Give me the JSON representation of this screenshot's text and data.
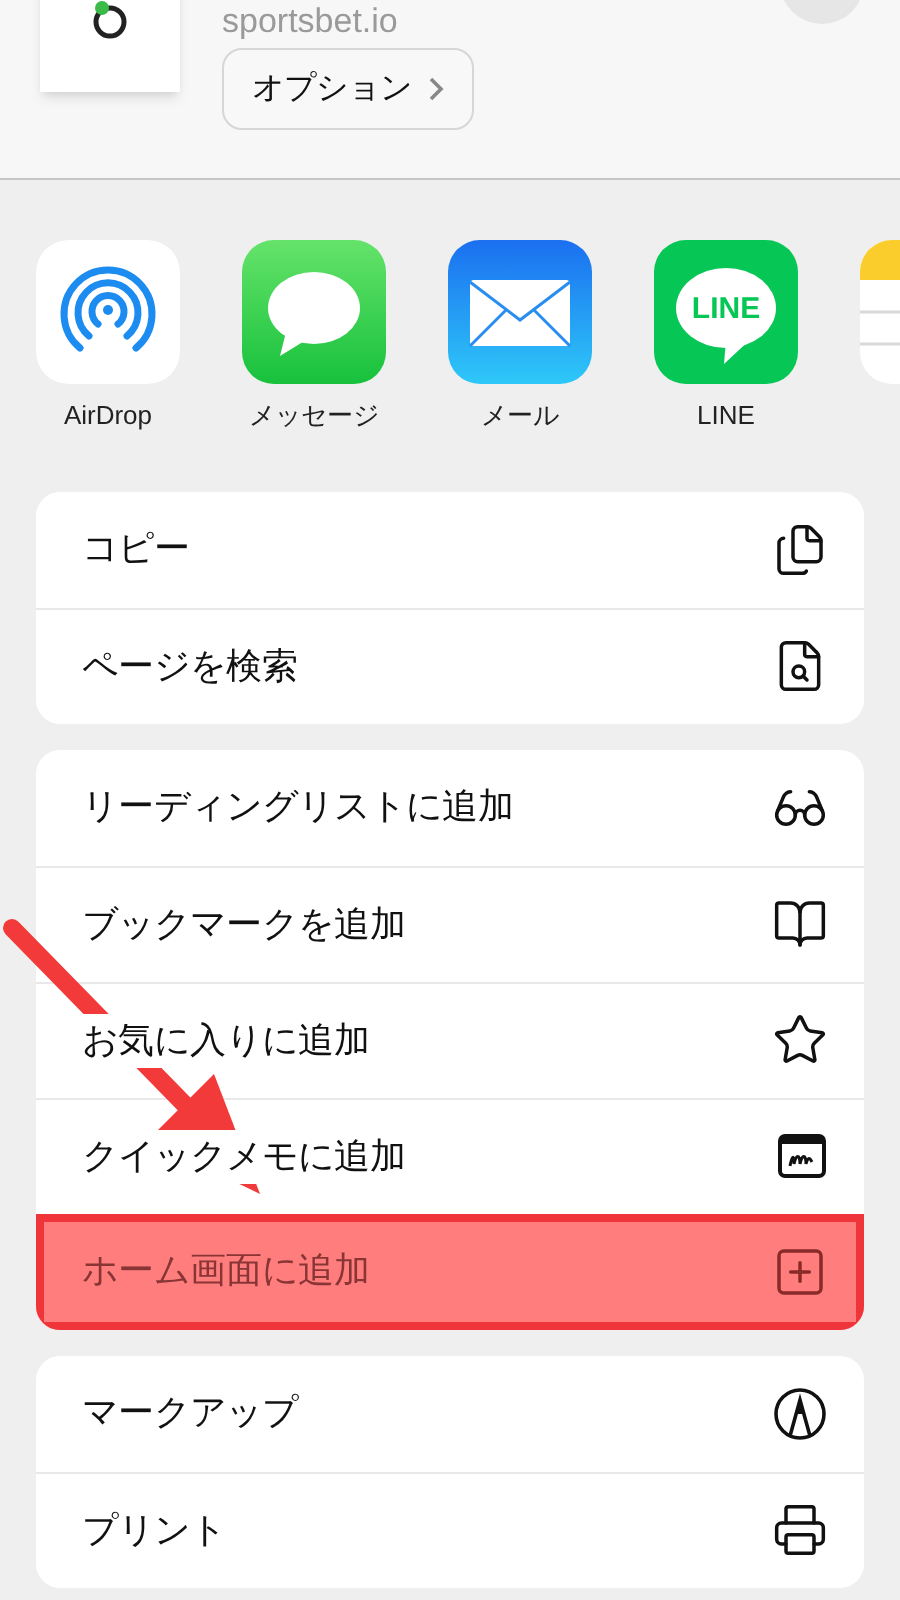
{
  "header": {
    "site": "sportsbet.io",
    "options_button": "オプション"
  },
  "apps": [
    {
      "kind": "airdrop",
      "label": "AirDrop"
    },
    {
      "kind": "messages",
      "label": "メッセージ"
    },
    {
      "kind": "mail",
      "label": "メール"
    },
    {
      "kind": "line",
      "label": "LINE",
      "logo_text": "LINE"
    },
    {
      "kind": "notes"
    }
  ],
  "action_groups": [
    [
      {
        "label": "コピー",
        "kind": "copy",
        "highlighted": false
      },
      {
        "label": "ページを検索",
        "kind": "find",
        "highlighted": false
      }
    ],
    [
      {
        "label": "リーディングリストに追加",
        "kind": "glasses",
        "highlighted": false
      },
      {
        "label": "ブックマークを追加",
        "kind": "book",
        "highlighted": false
      },
      {
        "label": "お気に入りに追加",
        "kind": "star",
        "highlighted": false
      },
      {
        "label": "クイックメモに追加",
        "kind": "note",
        "highlighted": false
      },
      {
        "label": "ホーム画面に追加",
        "kind": "plus",
        "highlighted": true
      }
    ],
    [
      {
        "label": "マークアップ",
        "kind": "markup",
        "highlighted": false
      },
      {
        "label": "プリント",
        "kind": "print",
        "highlighted": false
      }
    ]
  ],
  "annotation": {
    "kind": "arrow"
  }
}
